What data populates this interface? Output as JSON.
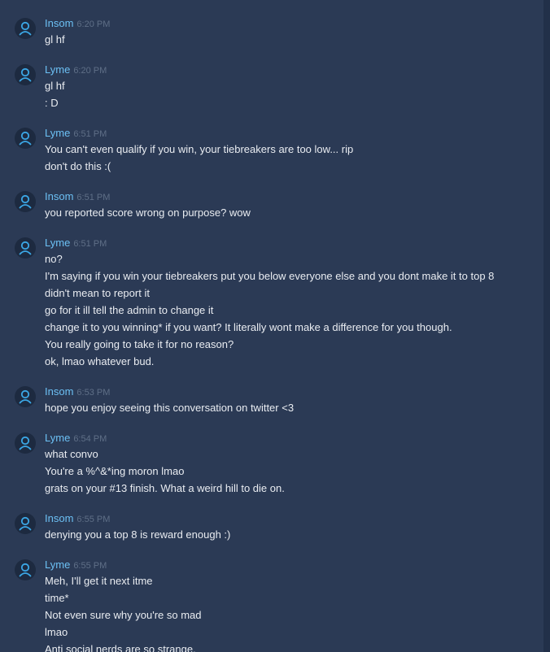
{
  "messages": [
    {
      "author": "Insom",
      "time": "6:20 PM",
      "lines": [
        "gl hf"
      ]
    },
    {
      "author": "Lyme",
      "time": "6:20 PM",
      "lines": [
        "gl hf",
        ": D"
      ]
    },
    {
      "author": "Lyme",
      "time": "6:51 PM",
      "lines": [
        "You can't even qualify if you win, your tiebreakers are too low... rip",
        "don't do this :("
      ]
    },
    {
      "author": "Insom",
      "time": "6:51 PM",
      "lines": [
        "you reported score wrong on purpose? wow"
      ]
    },
    {
      "author": "Lyme",
      "time": "6:51 PM",
      "lines": [
        "no?",
        "I'm saying if you win your tiebreakers put you below everyone else and you dont make it to top 8",
        "didn't mean to report it",
        "go for it ill tell the admin to change it",
        "change it to you winning* if you want? It literally wont make a difference for you though.",
        "You really going to take it for no reason?",
        "ok, lmao whatever bud."
      ]
    },
    {
      "author": "Insom",
      "time": "6:53 PM",
      "lines": [
        "hope you enjoy seeing this conversation on twitter <3"
      ]
    },
    {
      "author": "Lyme",
      "time": "6:54 PM",
      "lines": [
        "what convo",
        "You're a %^&*ing moron lmao",
        "grats on your #13 finish. What a weird hill to die on."
      ]
    },
    {
      "author": "Insom",
      "time": "6:55 PM",
      "lines": [
        "denying you a top 8 is reward enough :)"
      ]
    },
    {
      "author": "Lyme",
      "time": "6:55 PM",
      "lines": [
        "Meh, I'll get it next itme",
        "time*",
        "Not even sure why you're so mad",
        "lmao",
        "Anti social nerds are so strange."
      ]
    }
  ],
  "colors": {
    "background": "#2b3a55",
    "author": "#6cc0f4",
    "timestamp": "#5f6f87",
    "text": "#e9ecf1",
    "avatar_bg": "#1d2a40",
    "avatar_icon": "#3ba7e6"
  },
  "icons": {
    "avatar": "user-avatar-icon"
  }
}
